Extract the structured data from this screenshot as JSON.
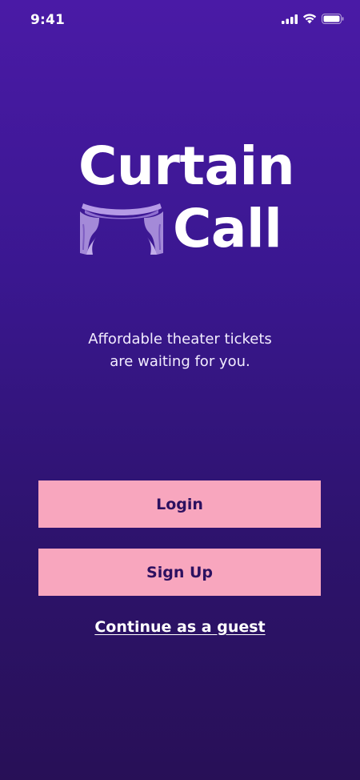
{
  "status_bar": {
    "time": "9:41",
    "icons": [
      "signal-icon",
      "wifi-icon",
      "battery-icon"
    ]
  },
  "logo": {
    "line1": "Curtain",
    "line2": "Call",
    "icon": "curtain-icon",
    "icon_color": "#a48ad8"
  },
  "tagline": {
    "line1": "Affordable theater tickets",
    "line2": "are waiting for you."
  },
  "actions": {
    "login_label": "Login",
    "signup_label": "Sign Up",
    "guest_label": "Continue as a guest"
  },
  "colors": {
    "background_top": "#4a1aa6",
    "background_bottom": "#281057",
    "button_bg": "#f8a6be",
    "button_text": "#2c1060"
  }
}
